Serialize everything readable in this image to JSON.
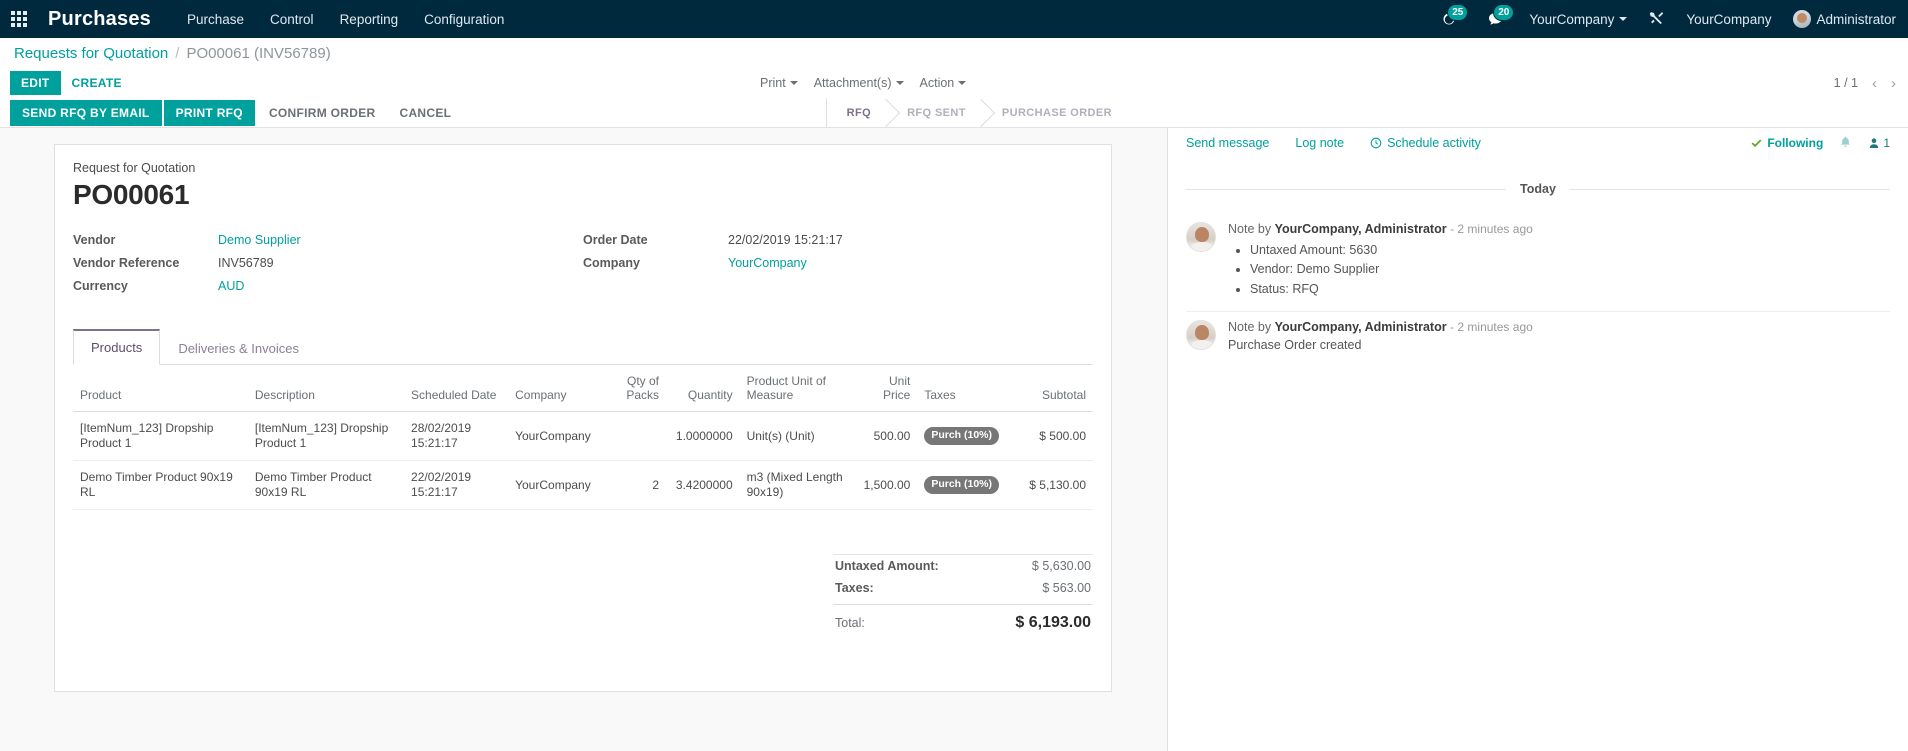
{
  "navbar": {
    "apps_icon": "apps-grid-icon",
    "brand": "Purchases",
    "menu": [
      {
        "label": "Purchase"
      },
      {
        "label": "Control"
      },
      {
        "label": "Reporting"
      },
      {
        "label": "Configuration"
      }
    ],
    "activity_badge": "25",
    "messages_badge": "20",
    "company_selector": "YourCompany",
    "tools_icon": "wrench-screwdriver-icon",
    "company_name": "YourCompany",
    "user_name": "Administrator",
    "accent": "#00a09d",
    "background": "#00293e"
  },
  "breadcrumb": {
    "root": "Requests for Quotation",
    "separator": "/",
    "current": "PO00061 (INV56789)"
  },
  "control_panel": {
    "edit_label": "EDIT",
    "create_label": "CREATE",
    "print_label": "Print",
    "attachments_label": "Attachment(s)",
    "action_label": "Action",
    "pager_text": "1 / 1",
    "prev_icon": "chevron-left-icon",
    "next_icon": "chevron-right-icon"
  },
  "statusbar": {
    "buttons": [
      {
        "label": "SEND RFQ BY EMAIL",
        "style": "primary"
      },
      {
        "label": "PRINT RFQ",
        "style": "primary"
      },
      {
        "label": "CONFIRM ORDER",
        "style": "link"
      },
      {
        "label": "CANCEL",
        "style": "link"
      }
    ],
    "stages": [
      {
        "label": "RFQ",
        "active": true
      },
      {
        "label": "RFQ SENT",
        "active": false
      },
      {
        "label": "PURCHASE ORDER",
        "active": false
      }
    ]
  },
  "form": {
    "subtitle": "Request for Quotation",
    "title": "PO00061",
    "left_fields": [
      {
        "label": "Vendor",
        "value": "Demo Supplier",
        "link": true
      },
      {
        "label": "Vendor Reference",
        "value": "INV56789",
        "link": false
      },
      {
        "label": "Currency",
        "value": "AUD",
        "link": true
      }
    ],
    "right_fields": [
      {
        "label": "Order Date",
        "value": "22/02/2019 15:21:17",
        "link": false
      },
      {
        "label": "Company",
        "value": "YourCompany",
        "link": true
      }
    ],
    "tabs": [
      {
        "label": "Products",
        "active": true
      },
      {
        "label": "Deliveries & Invoices",
        "active": false
      }
    ],
    "table": {
      "columns": [
        "Product",
        "Description",
        "Scheduled Date",
        "Company",
        "Qty of Packs",
        "Quantity",
        "Product Unit of Measure",
        "Unit Price",
        "Taxes",
        "Subtotal"
      ],
      "rows": [
        {
          "product": "[ItemNum_123] Dropship Product 1",
          "description": "[ItemNum_123] Dropship Product 1",
          "scheduled_date": "28/02/2019 15:21:17",
          "company": "YourCompany",
          "qty_of_packs": "",
          "quantity": "1.0000000",
          "uom": "Unit(s) (Unit)",
          "unit_price": "500.00",
          "taxes": "Purch (10%)",
          "subtotal": "$ 500.00"
        },
        {
          "product": "Demo Timber Product 90x19 RL",
          "description": "Demo Timber Product 90x19 RL",
          "scheduled_date": "22/02/2019 15:21:17",
          "company": "YourCompany",
          "qty_of_packs": "2",
          "quantity": "3.4200000",
          "uom": "m3 (Mixed Length 90x19)",
          "unit_price": "1,500.00",
          "taxes": "Purch (10%)",
          "subtotal": "$ 5,130.00"
        }
      ]
    },
    "totals": {
      "untaxed_label": "Untaxed Amount:",
      "untaxed_value": "$ 5,630.00",
      "taxes_label": "Taxes:",
      "taxes_value": "$ 563.00",
      "total_label": "Total:",
      "total_value": "$ 6,193.00"
    }
  },
  "chatter": {
    "send_message": "Send message",
    "log_note": "Log note",
    "schedule_activity": "Schedule activity",
    "schedule_icon": "clock-icon",
    "following_label": "Following",
    "follow_check_icon": "check-icon",
    "bell_icon": "bell-icon",
    "followers_icon": "user-icon",
    "followers_count": "1",
    "day_separator": "Today",
    "messages": [
      {
        "author_prefix": "Note by",
        "author": "YourCompany, Administrator",
        "timestamp": "- 2 minutes ago",
        "bullets": [
          "Untaxed Amount: 5630",
          "Vendor: Demo Supplier",
          "Status: RFQ"
        ],
        "text": ""
      },
      {
        "author_prefix": "Note by",
        "author": "YourCompany, Administrator",
        "timestamp": "- 2 minutes ago",
        "bullets": [],
        "text": "Purchase Order created"
      }
    ]
  }
}
